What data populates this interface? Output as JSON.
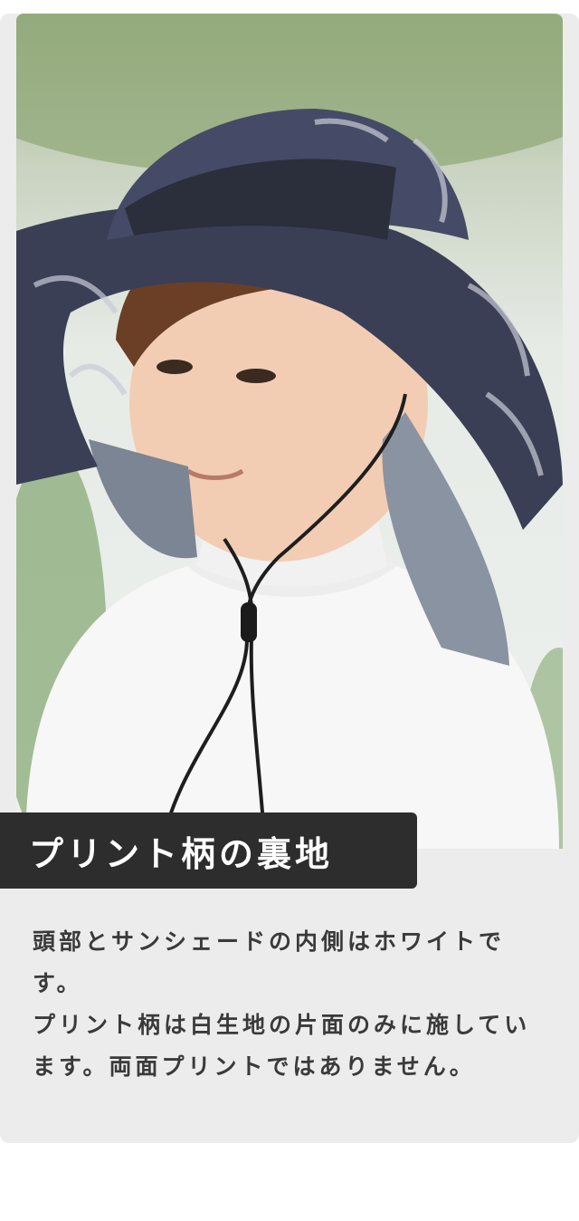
{
  "section": {
    "label": "プリント柄の裏地",
    "paragraph1": "頭部とサンシェードの内側はホワイトです。",
    "paragraph2": "プリント柄は白生地の片面のみに施しています。両面プリントではありません。"
  },
  "photo": {
    "subject": "product-photo-child-wearing-sun-hat"
  },
  "colors": {
    "card_background": "#ececec",
    "label_background": "#2d2d2d",
    "label_text": "#ffffff",
    "body_text": "#3a3a3a"
  }
}
